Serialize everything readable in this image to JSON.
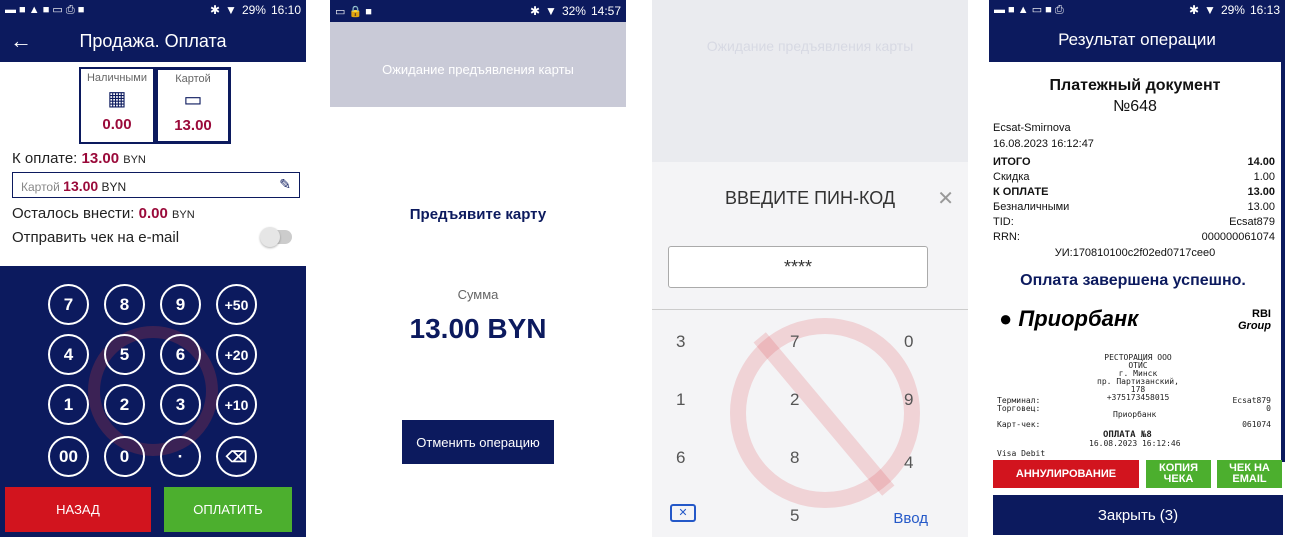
{
  "screen1": {
    "status": {
      "battery": "29%",
      "time": "16:10"
    },
    "title": "Продажа. Оплата",
    "cash": {
      "label": "Наличными",
      "amount": "0.00"
    },
    "card": {
      "label": "Картой",
      "amount": "13.00"
    },
    "to_pay": {
      "label": "К оплате:",
      "amount": "13.00",
      "currency": "BYN"
    },
    "card_field": {
      "label": "Картой",
      "amount": "13.00",
      "currency": "BYN"
    },
    "remaining": {
      "label": "Осталось внести:",
      "amount": "0.00",
      "currency": "BYN"
    },
    "email_label": "Отправить чек на e-mail",
    "keys": [
      "7",
      "8",
      "9",
      "+50",
      "4",
      "5",
      "6",
      "+20",
      "1",
      "2",
      "3",
      "+10",
      "00",
      "0",
      "·",
      "⌫"
    ],
    "back_button": "НАЗАД",
    "pay_button": "ОПЛАТИТЬ"
  },
  "screen2": {
    "status": {
      "battery": "32%",
      "time": "14:57"
    },
    "waiting": "Ожидание предъявления карты",
    "present": "Предъявите карту",
    "sum_label": "Сумма",
    "sum_value": "13.00 BYN",
    "cancel_button": "Отменить операцию"
  },
  "screen3": {
    "waiting": "Ожидание предъявления карты",
    "pin_title": "ВВЕДИТЕ ПИН-КОД",
    "pin_value": "****",
    "keys": [
      "3",
      "7",
      "0",
      "1",
      "2",
      "9",
      "6",
      "8",
      "4",
      "5"
    ],
    "enter": "Ввод"
  },
  "screen4": {
    "status": {
      "battery": "29%",
      "time": "16:13"
    },
    "title": "Результат операции",
    "doc_title": "Платежный документ",
    "doc_number": "№648",
    "cashier": "Ecsat-Smirnova",
    "datetime": "16.08.2023 16:12:47",
    "rows": [
      {
        "label": "ИТОГО",
        "value": "14.00",
        "bold": true
      },
      {
        "label": "Скидка",
        "value": "1.00",
        "bold": false
      },
      {
        "label": "К ОПЛАТЕ",
        "value": "13.00",
        "bold": true
      },
      {
        "label": "Безналичными",
        "value": "13.00",
        "bold": false
      },
      {
        "label": "TID:",
        "value": "Ecsat879",
        "bold": false
      },
      {
        "label": "RRN:",
        "value": "000000061074",
        "bold": false
      }
    ],
    "ui": "УИ:170810100c2f02ed0717cee0",
    "success": "Оплата завершена успешно.",
    "receipt": {
      "bank": "Приорбанк",
      "group": "RBI",
      "group_sub": "Group",
      "address": [
        "РЕСТОРАЦИЯ ООО",
        "ОТИС",
        "г. Минск",
        "пр. Партизанский, 178",
        "+375173458015"
      ],
      "terminal_label": "Терминал:",
      "terminal_value": "Ecsat879",
      "merchant_label": "Торговец:",
      "merchant_value": "0",
      "bank_line": "Приорбанк",
      "cardcheck_label": "Карт-чек:",
      "cardcheck_value": "061074",
      "payment": "ОПЛАТА №8",
      "payment_time": "16.08.2023 16:12:46",
      "card_type": "Visa Debit"
    },
    "annul_button": "АННУЛИРОВАНИЕ",
    "copy_button": "КОПИЯ ЧЕКА",
    "email_button": "ЧЕК НА EMAIL",
    "close_button": "Закрыть (3)"
  }
}
